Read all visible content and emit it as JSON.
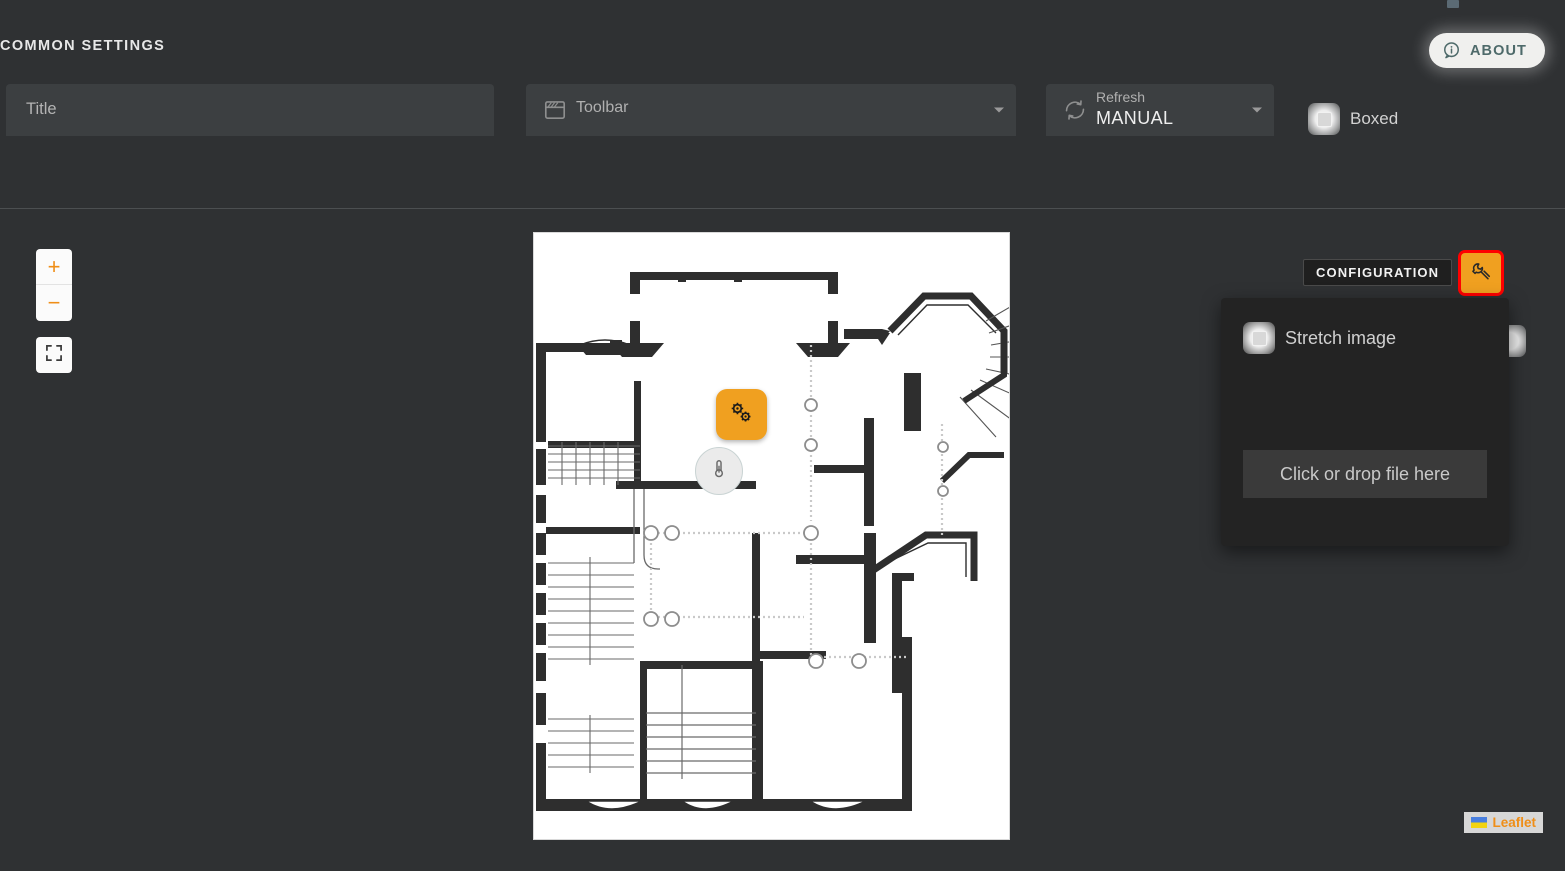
{
  "header": {
    "title": "COMMON SETTINGS",
    "about_label": "ABOUT",
    "about_icon": "info-icon"
  },
  "settings": {
    "title_field": {
      "value": "",
      "placeholder": "Title",
      "name": "title-input"
    },
    "toolbar_field": {
      "label": "Toolbar",
      "value": "",
      "icon": "toolbar-icon",
      "caret": "chevron-down-icon"
    },
    "refresh_field": {
      "label": "Refresh",
      "value": "MANUAL",
      "icon": "refresh-icon",
      "caret": "chevron-down-icon",
      "options": [
        "MANUAL"
      ]
    },
    "boxed_checkbox": {
      "label": "Boxed",
      "checked": false
    }
  },
  "map": {
    "zoom_in_label": "+",
    "zoom_out_label": "−",
    "fullscreen_icon": "fullscreen-icon",
    "attribution": "Leaflet",
    "attribution_flag": "ukraine-flag-icon",
    "markers": [
      {
        "icon": "gears-icon",
        "shape": "rounded-square",
        "color": "#f0a020"
      },
      {
        "icon": "thermometer-icon",
        "shape": "circle",
        "color": "#ebebeb"
      }
    ]
  },
  "configuration": {
    "tooltip": "CONFIGURATION",
    "button_icon": "wrench-icon",
    "button_color": "#f0a020",
    "button_highlight_color": "#ff0000",
    "stretch_checkbox": {
      "label": "Stretch image",
      "checked": false
    },
    "dropzone_label": "Click or drop file here"
  }
}
